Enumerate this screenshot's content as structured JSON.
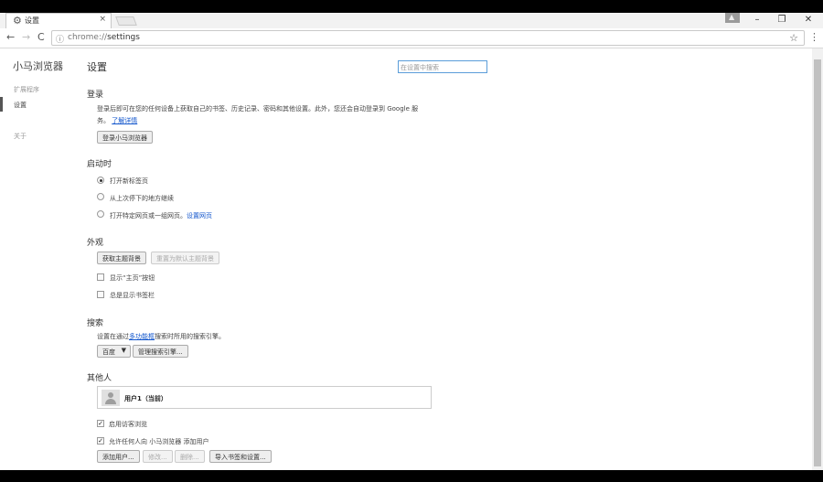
{
  "tab": {
    "title": "设置",
    "icon": "gear-icon",
    "close": "×"
  },
  "window": {
    "minimize": "–",
    "restore": "❐",
    "close": "✕",
    "user": "▲"
  },
  "nav": {
    "back": "←",
    "forward": "→",
    "reload": "C"
  },
  "omnibox": {
    "scheme": "chrome://",
    "path": "settings",
    "star": "☆",
    "info": "ⓘ"
  },
  "menu": "⋮",
  "sidebar": {
    "brand": "小马浏览器",
    "items": [
      {
        "label": "扩展程序"
      },
      {
        "label": "设置"
      },
      {
        "label": "关于"
      }
    ]
  },
  "page": {
    "title": "设置",
    "search_placeholder": "在设置中搜索"
  },
  "signin": {
    "heading": "登录",
    "text1": "登录后即可在您的任何设备上获取自己的书签、历史记录、密码和其他设置。此外，您还会自动登录到 Google 服",
    "text2": "务。",
    "link": "了解详情",
    "button": "登录小马浏览器"
  },
  "startup": {
    "heading": "启动时",
    "options": [
      "打开新标签页",
      "从上次停下的地方继续",
      "打开特定网页或一组网页。"
    ],
    "link": "设置网页"
  },
  "appearance": {
    "heading": "外观",
    "get_themes": "获取主题背景",
    "reset_theme": "重置为默认主题背景",
    "show_home": "显示“主页”按钮",
    "show_bookmarks": "总是显示书签栏"
  },
  "search": {
    "heading": "搜索",
    "text_before": "设置在通过",
    "link": "多功能框",
    "text_after": "搜索时所用的搜索引擎。",
    "engine": "百度",
    "manage": "管理搜索引擎..."
  },
  "people": {
    "heading": "其他人",
    "user": "用户1（当前）",
    "guest": "启用访客浏览",
    "allow_add": "允许任何人向 小马浏览器 添加用户",
    "add": "添加用户...",
    "edit": "修改...",
    "delete": "删除...",
    "import": "导入书签和设置..."
  }
}
